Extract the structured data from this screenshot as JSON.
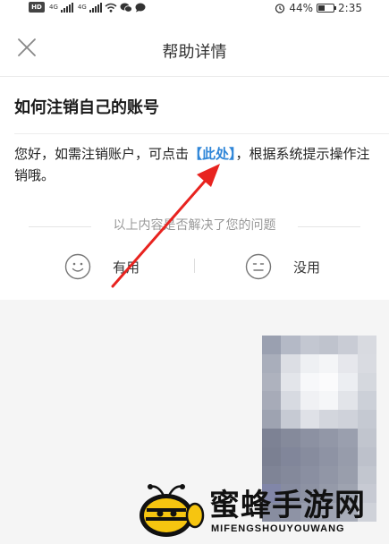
{
  "status_bar": {
    "hd_badge": "HD",
    "network_1": "4G",
    "network_2": "4G",
    "battery_percent": "44%",
    "battery_level": 0.44,
    "time": "2:35",
    "icons": [
      "wifi-icon",
      "wechat-icon",
      "message-icon",
      "alarm-icon",
      "battery-icon"
    ]
  },
  "header": {
    "title": "帮助详情",
    "close_icon": "close-icon"
  },
  "article": {
    "title": "如何注销自己的账号",
    "body_before": "您好，如需注销账户，可点击",
    "link_text": "【此处】",
    "body_after": "，根据系统提示操作注销哦。"
  },
  "feedback": {
    "question": "以上内容是否解决了您的问题",
    "useful_label": "有用",
    "useless_label": "没用"
  },
  "watermark": {
    "text": "蜜蜂手游网",
    "subtext": "MIFENGSHOUYOUWANG"
  },
  "colors": {
    "link": "#2f86d8",
    "annotation_arrow": "#e8231f",
    "panel": "#f5f5f5"
  }
}
